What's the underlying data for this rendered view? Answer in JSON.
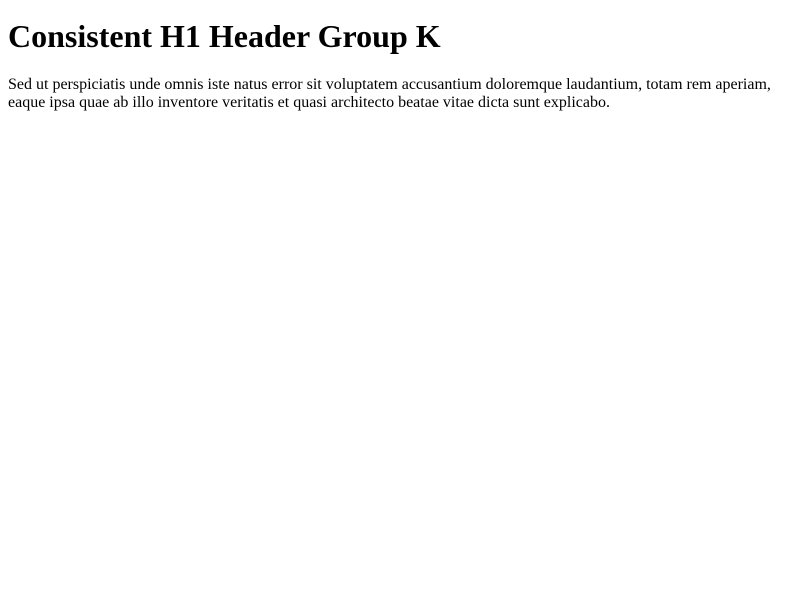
{
  "page": {
    "heading": "Consistent H1 Header Group K",
    "paragraph": "Sed ut perspiciatis unde omnis iste natus error sit voluptatem accusantium doloremque laudantium, totam rem aperiam, eaque ipsa quae ab illo inventore veritatis et quasi architecto beatae vitae dicta sunt explicabo."
  },
  "colors": {
    "background": "#ffffff",
    "text": "#000000"
  }
}
